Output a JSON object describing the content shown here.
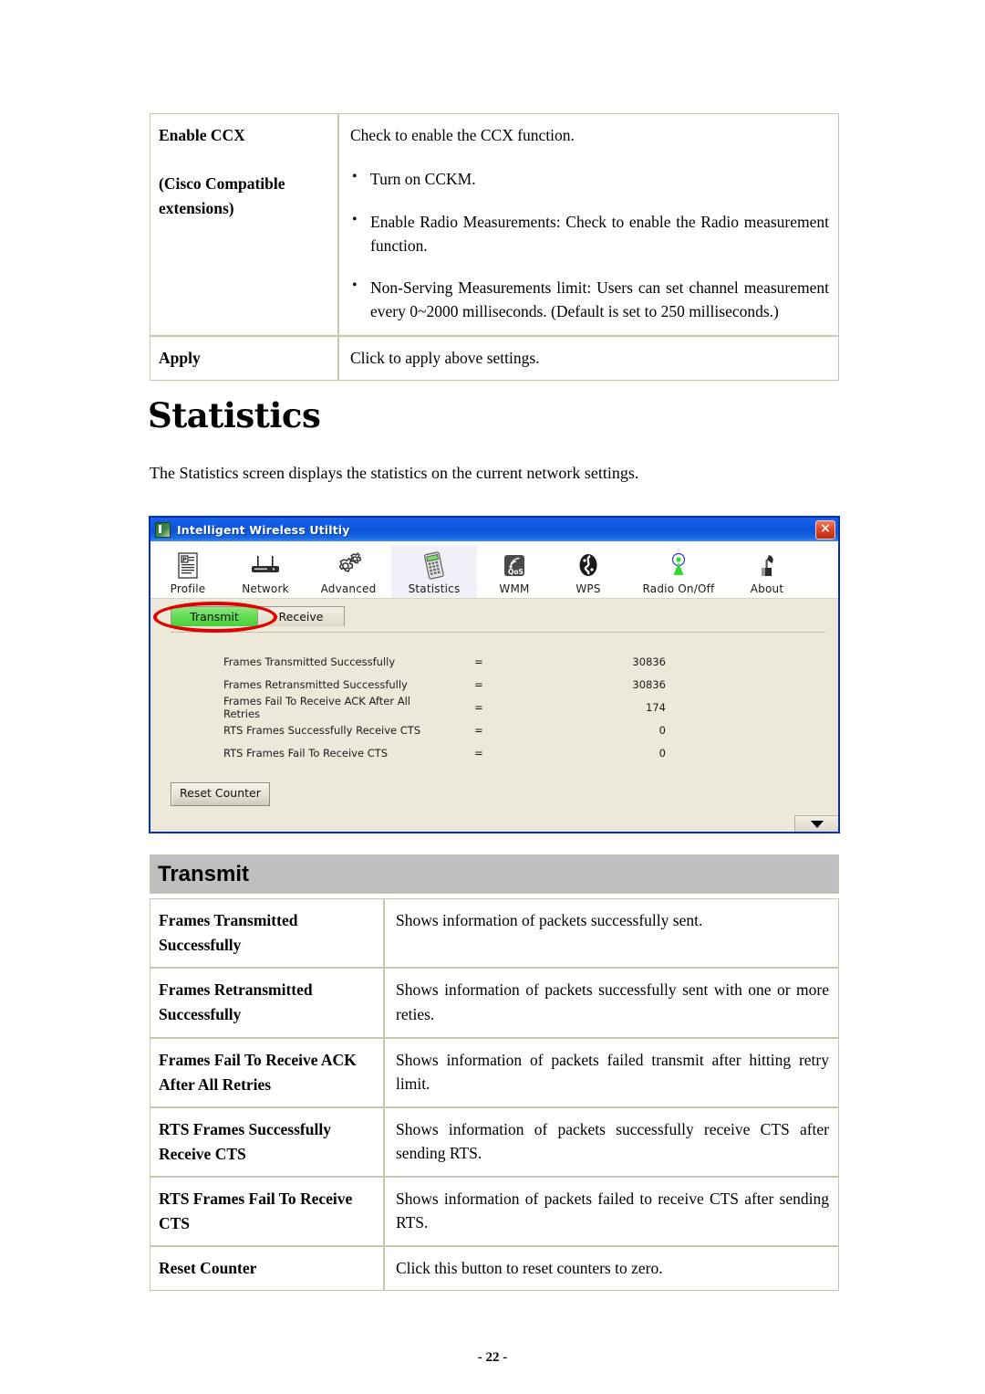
{
  "ccx_table": {
    "rows": [
      {
        "label": "Enable CCX",
        "label2": "(Cisco Compatible",
        "label3": "extensions)",
        "intro": "Check to enable the CCX function.",
        "bullets": [
          "Turn on CCKM.",
          "Enable Radio Measurements: Check to enable the Radio measurement function.",
          "Non-Serving Measurements limit: Users can set channel measurement every 0~2000 milliseconds. (Default is set to 250 milliseconds.)"
        ]
      },
      {
        "label": "Apply",
        "desc": "Click to apply above settings."
      }
    ]
  },
  "heading": "Statistics",
  "intro": "The Statistics screen displays the statistics on the current network settings.",
  "app_window": {
    "title": "Intelligent Wireless Utiltiy",
    "close_label": "×",
    "toolbar": [
      {
        "label": "Profile",
        "icon": "profile-icon",
        "selected": false
      },
      {
        "label": "Network",
        "icon": "router-icon",
        "selected": false
      },
      {
        "label": "Advanced",
        "icon": "gears-icon",
        "selected": false
      },
      {
        "label": "Statistics",
        "icon": "calculator-icon",
        "selected": true
      },
      {
        "label": "WMM",
        "icon": "qos-icon",
        "selected": false
      },
      {
        "label": "WPS",
        "icon": "wps-icon",
        "selected": false
      },
      {
        "label": "Radio On/Off",
        "icon": "antenna-icon",
        "selected": false
      },
      {
        "label": "About",
        "icon": "satellite-dish-icon",
        "selected": false
      }
    ],
    "tabs": [
      {
        "label": "Transmit",
        "active": true
      },
      {
        "label": "Receive",
        "active": false
      }
    ],
    "stats": [
      {
        "name": "Frames Transmitted Successfully",
        "eq": "=",
        "value": "30836"
      },
      {
        "name": "Frames Retransmitted Successfully",
        "eq": "=",
        "value": "30836"
      },
      {
        "name": "Frames Fail To Receive ACK After All Retries",
        "eq": "=",
        "value": "174"
      },
      {
        "name": "RTS Frames Successfully Receive CTS",
        "eq": "=",
        "value": "0"
      },
      {
        "name": "RTS Frames Fail To Receive CTS",
        "eq": "=",
        "value": "0"
      }
    ],
    "reset_button": "Reset Counter",
    "accent_title_color": "#0c54d6",
    "active_tab_color": "#62dd55",
    "highlight_ellipse_color": "#e00000"
  },
  "transmit_section": {
    "header": "Transmit",
    "rows": [
      {
        "label": "Frames Transmitted Successfully",
        "desc": "Shows information of packets successfully sent."
      },
      {
        "label": "Frames Retransmitted Successfully",
        "desc": "Shows information of packets successfully sent with one or more reties."
      },
      {
        "label": "Frames Fail To Receive ACK After All Retries",
        "desc": "Shows information of packets failed transmit after hitting retry limit."
      },
      {
        "label": "RTS Frames Successfully Receive CTS",
        "desc": "Shows information of packets successfully receive CTS after sending RTS."
      },
      {
        "label": "RTS Frames Fail To Receive CTS",
        "desc": "Shows information of packets failed to receive CTS after sending RTS."
      },
      {
        "label": "Reset Counter",
        "desc": "Click this button to reset counters to zero."
      }
    ]
  },
  "page_number": "- 22 -"
}
